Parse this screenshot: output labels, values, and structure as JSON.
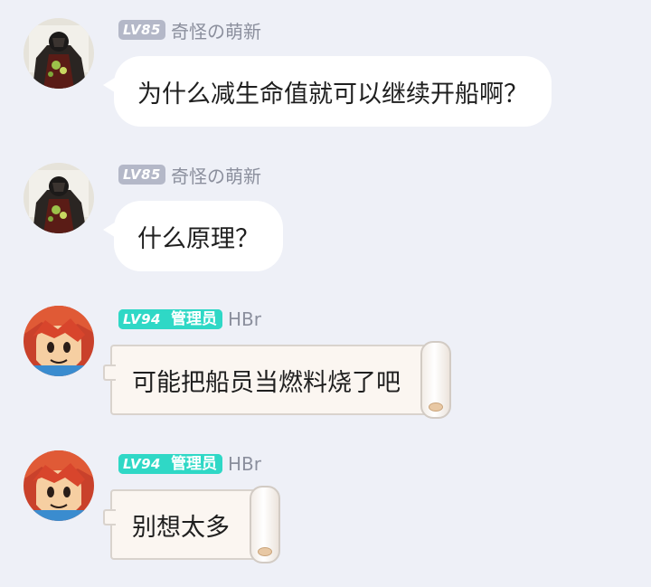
{
  "messages": [
    {
      "level": "LV85",
      "role": "",
      "name": "奇怪の萌新",
      "text": "为什么减生命值就可以继续开船啊？",
      "avatar": "dark-knight-avatar",
      "bubble_style": "plain"
    },
    {
      "level": "LV85",
      "role": "",
      "name": "奇怪の萌新",
      "text": "什么原理？",
      "avatar": "dark-knight-avatar",
      "bubble_style": "plain"
    },
    {
      "level": "LV94",
      "role": "管理员",
      "name": "HBr",
      "text": "可能把船员当燃料烧了吧",
      "avatar": "red-hair-cartoon-avatar",
      "bubble_style": "scroll"
    },
    {
      "level": "LV94",
      "role": "管理员",
      "name": "HBr",
      "text": "别想太多",
      "avatar": "red-hair-cartoon-avatar",
      "bubble_style": "scroll"
    }
  ],
  "colors": {
    "background": "#eef0f7",
    "level_gray": "#b4b8c8",
    "level_admin": "#2fd8c6",
    "username": "#8b8f9d"
  }
}
